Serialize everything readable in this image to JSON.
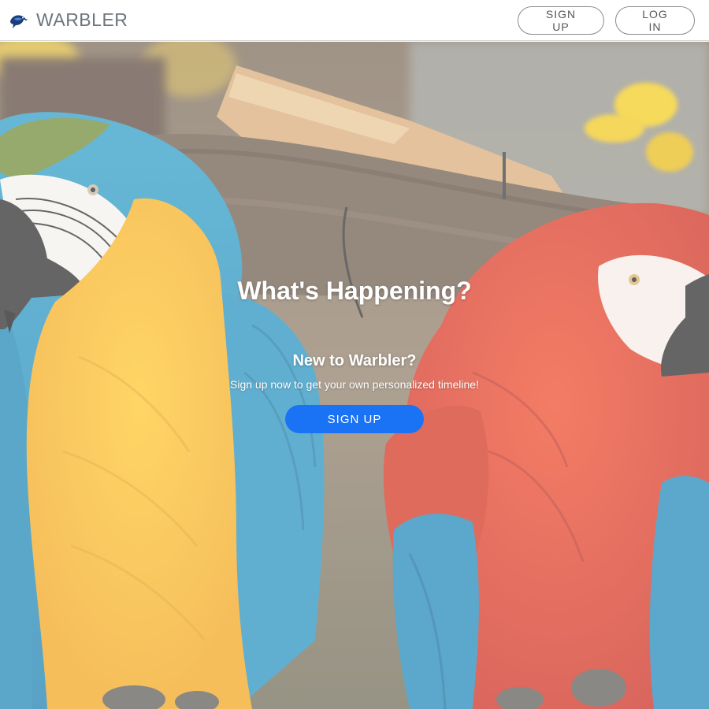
{
  "navbar": {
    "brand_name": "WARBLER",
    "signup_label": "SIGN UP",
    "login_label": "LOG IN"
  },
  "hero": {
    "title": "What's Happening?",
    "subtitle": "New to Warbler?",
    "text": "Sign up now to get your own personalized timeline!",
    "cta_label": "SIGN UP",
    "background_image": "two macaws (blue-and-yellow and scarlet) perched on a branch"
  },
  "colors": {
    "primary": "#1a73f5",
    "brand_text": "#6c757d",
    "outline": "#8a8a8a"
  },
  "icons": {
    "brand_logo": "warbler-bird-icon"
  }
}
